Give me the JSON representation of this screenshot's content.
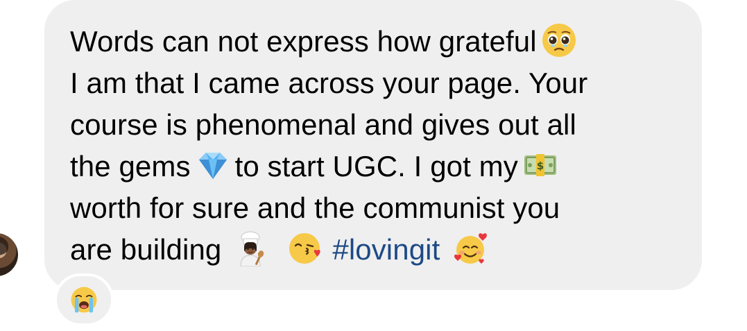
{
  "message": {
    "line1": "Words can not express how grateful",
    "line2": "I am that I came across your page. Your",
    "line3": "course is phenomenal and gives out all",
    "line4_a": "the gems",
    "line4_b": "to start UGC. I got my",
    "line5": "worth for sure and the communist you",
    "line6_a": "are building",
    "hashtag": "#lovingit"
  },
  "emojis": {
    "pleading": "pleading-face-emoji",
    "gem": "gem-stone-emoji",
    "money": "dollar-banknote-emoji",
    "cook": "woman-cook-emoji",
    "kiss": "face-blowing-kiss-emoji",
    "hearts": "smiling-face-with-hearts-emoji"
  },
  "reaction": {
    "emoji": "loudly-crying-face-emoji"
  },
  "colors": {
    "bubble": "#efefef",
    "hashtag": "#1d4a86",
    "background": "#ffffff"
  }
}
